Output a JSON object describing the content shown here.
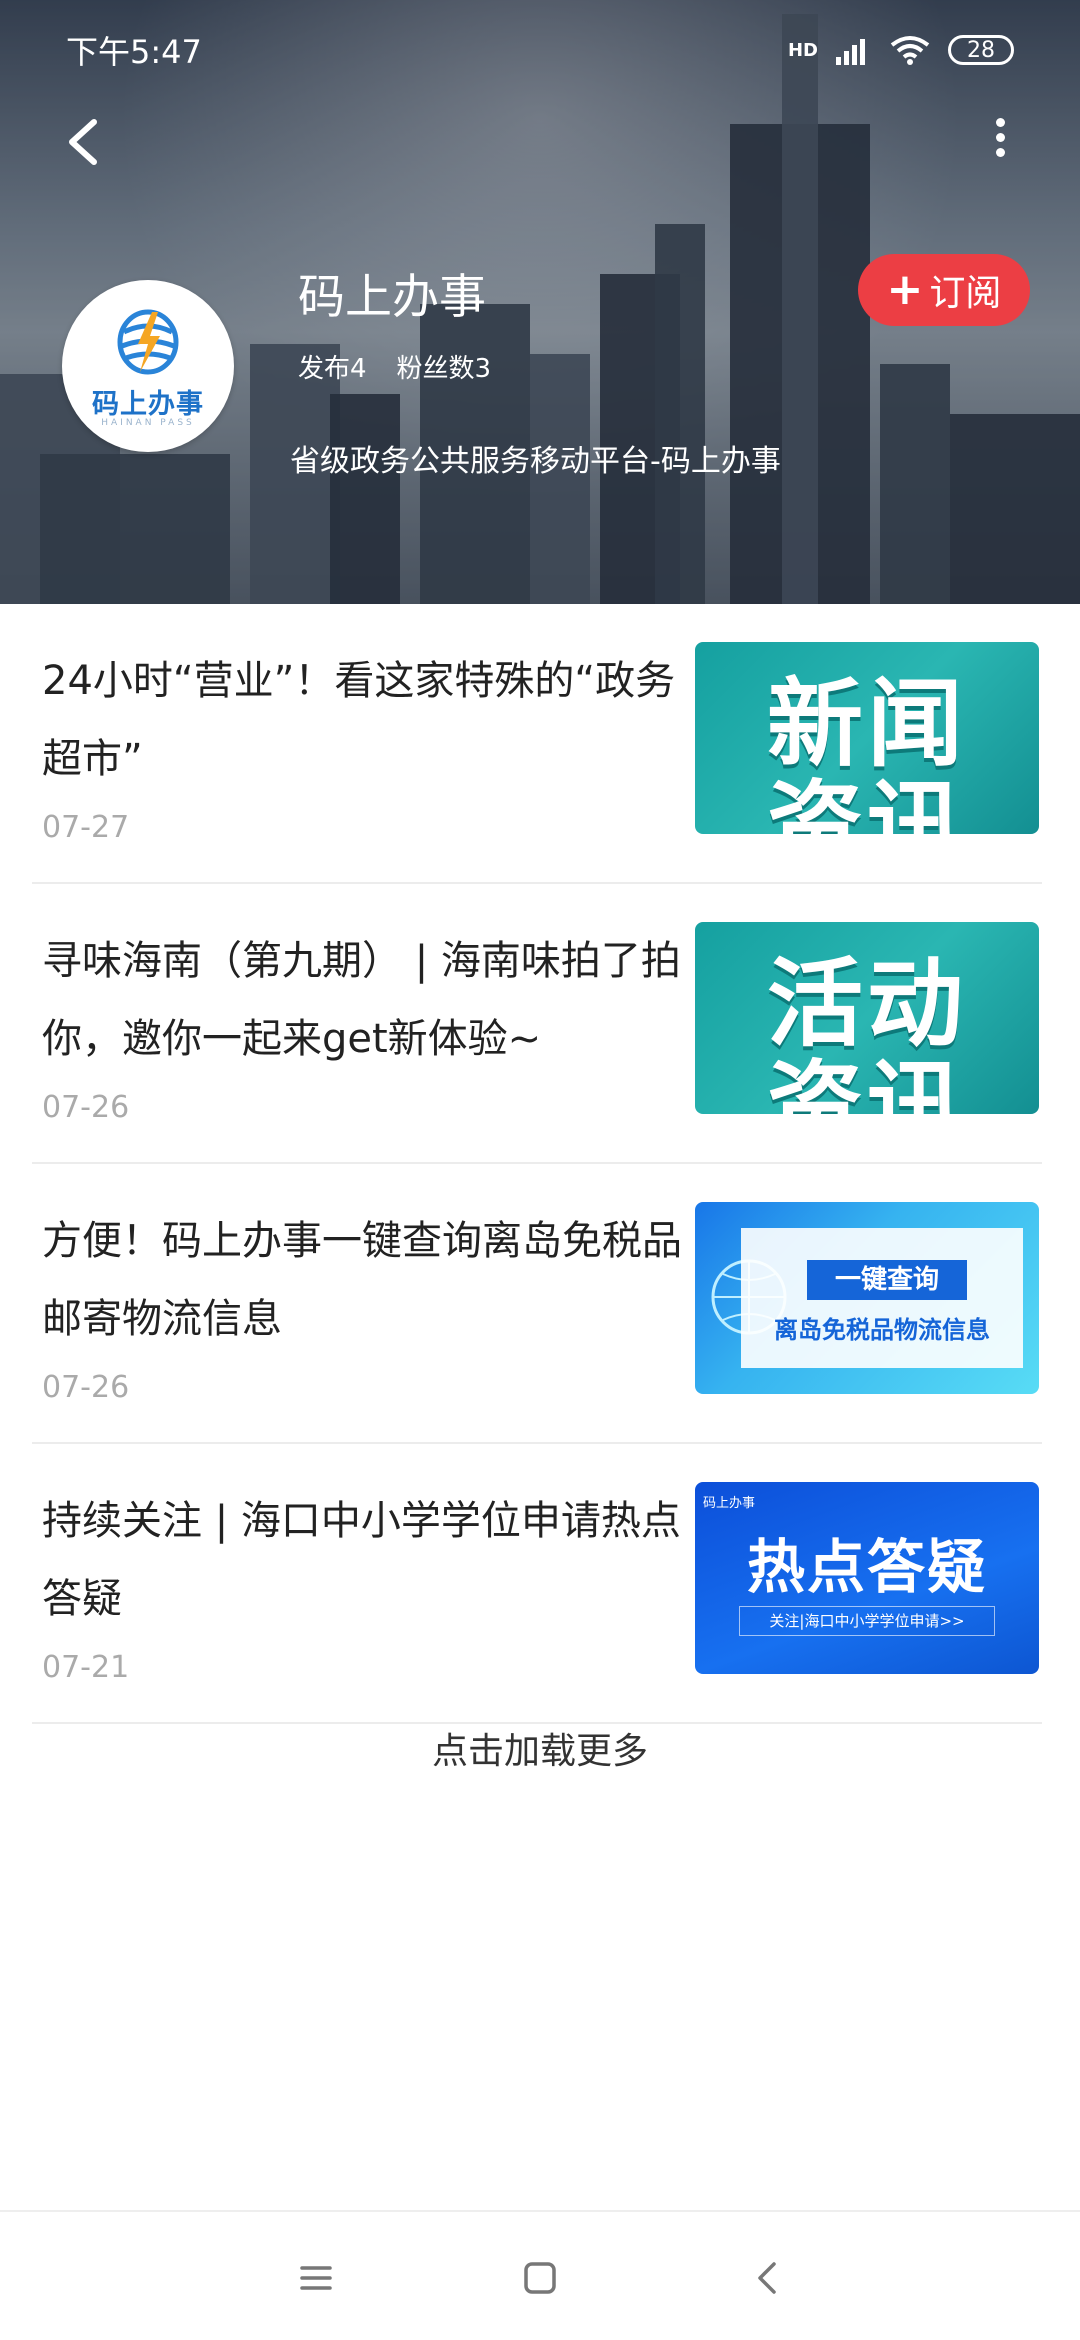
{
  "status_bar": {
    "time": "下午5:47",
    "network": "HD",
    "battery": "28"
  },
  "header": {
    "back_icon": "chevron-left-icon",
    "more_icon": "more-vertical-icon"
  },
  "account": {
    "logo_text": "码上办事",
    "logo_subtext": "HAINAN PASS",
    "name": "码上办事",
    "posts_label": "发布4",
    "fans_label": "粉丝数3",
    "description": "省级政务公共服务移动平台-码上办事",
    "subscribe_label": "订阅",
    "subscribe_color": "#ec3e44"
  },
  "articles": [
    {
      "title": "24小时“营业”！看这家特殊的“政务超市”",
      "date": "07-27",
      "thumb_line1": "新闻",
      "thumb_line2": "资讯"
    },
    {
      "title": "寻味海南（第九期） | 海南味拍了拍你，邀你一起来get新体验~",
      "date": "07-26",
      "thumb_line1": "活动",
      "thumb_line2": "资讯"
    },
    {
      "title": "方便！码上办事一键查询离岛免税品邮寄物流信息",
      "date": "07-26",
      "thumb_line1": "一键查询",
      "thumb_line2": "离岛免税品物流信息"
    },
    {
      "title": "持续关注 | 海口中小学学位申请热点答疑",
      "date": "07-21",
      "thumb_brand": "码上办事",
      "thumb_line1": "热点答疑",
      "thumb_line2": "关注|海口中小学学位申请>>"
    }
  ],
  "load_more": "点击加载更多",
  "nav": {
    "menu_icon": "menu-icon",
    "home_icon": "home-square-icon",
    "back_icon": "back-triangle-icon"
  }
}
